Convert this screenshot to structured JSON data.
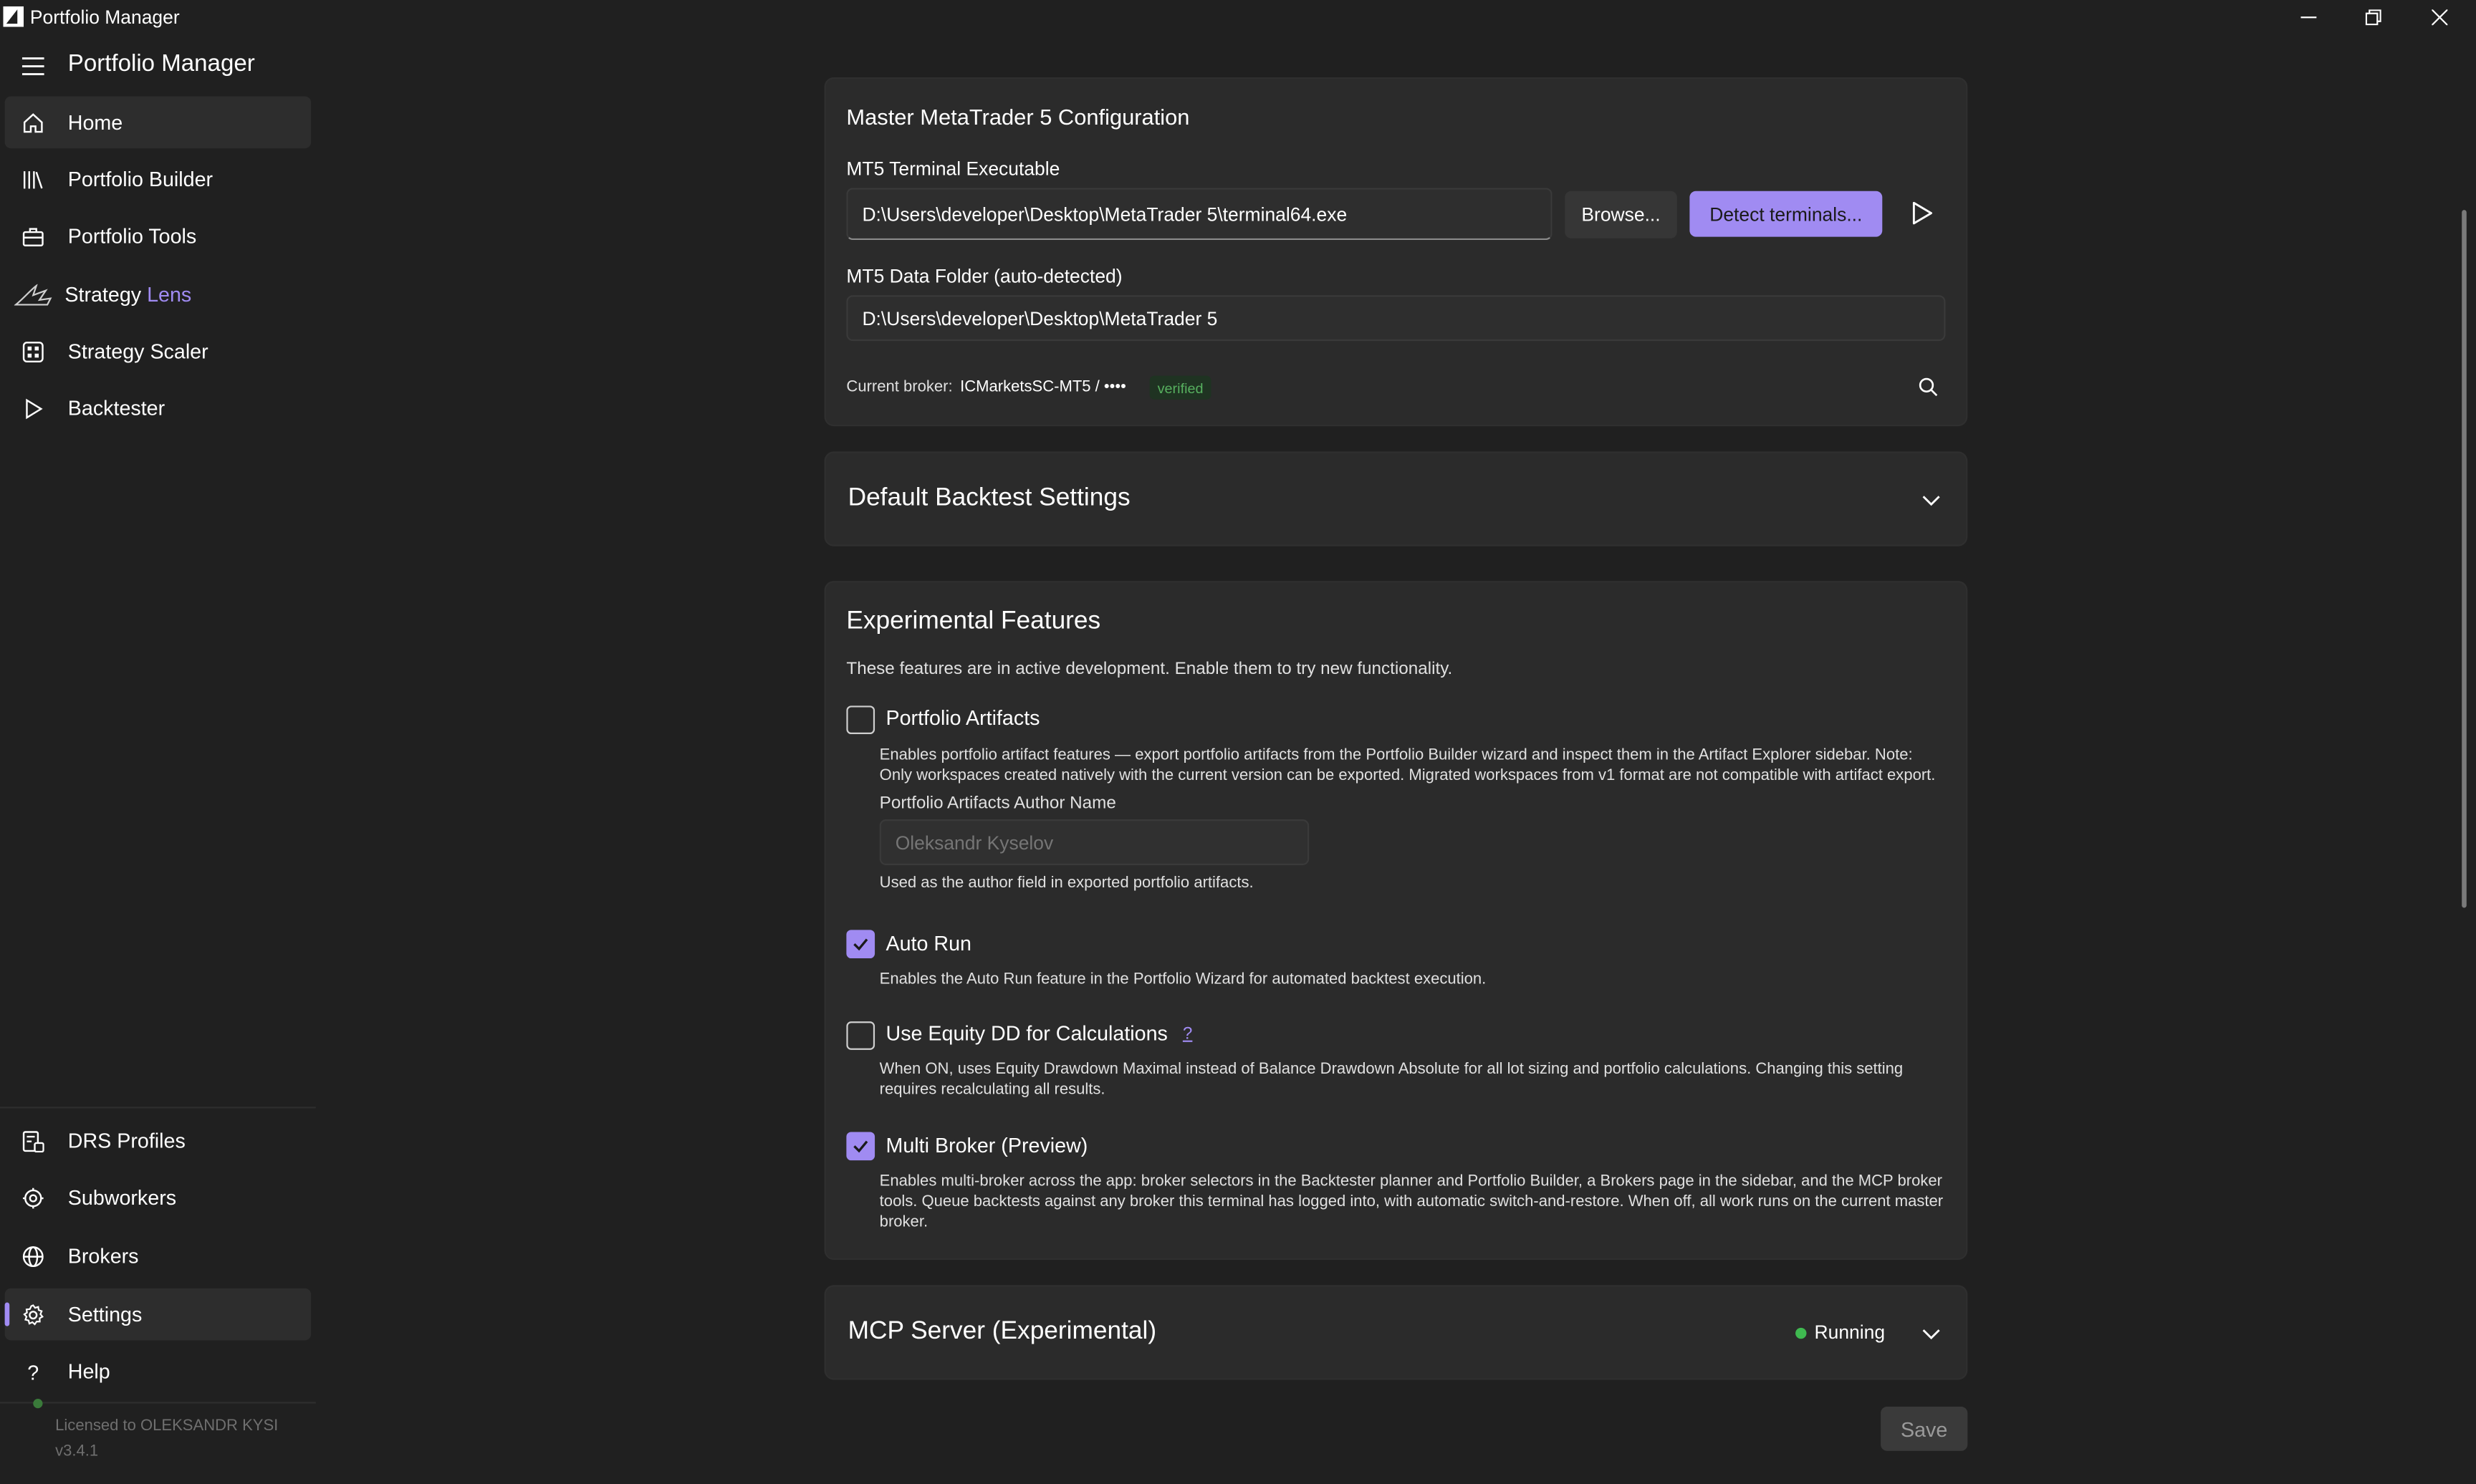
{
  "window": {
    "title": "Portfolio Manager"
  },
  "sidebar": {
    "app_name": "Portfolio Manager",
    "items": [
      {
        "label": "Home"
      },
      {
        "label": "Portfolio Builder"
      },
      {
        "label": "Portfolio Tools"
      },
      {
        "label_a": "Strategy",
        "label_b": "Lens"
      },
      {
        "label": "Strategy Scaler"
      },
      {
        "label": "Backtester"
      }
    ],
    "bottom_items": [
      {
        "label": "DRS Profiles"
      },
      {
        "label": "Subworkers"
      },
      {
        "label": "Brokers"
      },
      {
        "label": "Settings"
      },
      {
        "label": "Help"
      }
    ],
    "license": "Licensed to OLEKSANDR KYSI",
    "version": "v3.4.1"
  },
  "mt5": {
    "title": "Master MetaTrader 5 Configuration",
    "exe_label": "MT5 Terminal Executable",
    "exe_value": "D:\\Users\\developer\\Desktop\\MetaTrader 5\\terminal64.exe",
    "browse_label": "Browse...",
    "detect_label": "Detect terminals...",
    "data_label": "MT5 Data Folder (auto-detected)",
    "data_value": "D:\\Users\\developer\\Desktop\\MetaTrader 5",
    "broker_prefix": "Current broker:",
    "broker_value": "ICMarketsSC-MT5 / ••••",
    "broker_badge": "verified"
  },
  "backtest": {
    "title": "Default Backtest Settings"
  },
  "experimental": {
    "title": "Experimental Features",
    "subtitle": "These features are in active development. Enable them to try new functionality.",
    "artifacts": {
      "label": "Portfolio Artifacts",
      "checked": false,
      "desc1": "Enables portfolio artifact features — export portfolio artifacts from the Portfolio Builder wizard and inspect them in the Artifact Explorer sidebar. Note:",
      "desc2": "Only workspaces created natively with the current version can be exported. Migrated workspaces from v1 format are not compatible with artifact export.",
      "author_label": "Portfolio Artifacts Author Name",
      "author_placeholder": "Oleksandr Kyselov",
      "author_help": "Used as the author field in exported portfolio artifacts."
    },
    "autorun": {
      "label": "Auto Run",
      "checked": true,
      "desc": "Enables the Auto Run feature in the Portfolio Wizard for automated backtest execution."
    },
    "equity": {
      "label": "Use Equity DD for Calculations",
      "help": "?",
      "checked": false,
      "desc1": "When ON, uses Equity Drawdown Maximal instead of Balance Drawdown Absolute for all lot sizing and portfolio calculations. Changing this setting",
      "desc2": "requires recalculating all results."
    },
    "multibroker": {
      "label": "Multi Broker (Preview)",
      "checked": true,
      "desc1": "Enables multi-broker across the app: broker selectors in the Backtester planner and Portfolio Builder, a Brokers page in the sidebar, and the MCP broker",
      "desc2": "tools. Queue backtests against any broker this terminal has logged into, with automatic switch-and-restore. When off, all work runs on the current master",
      "desc3": "broker."
    }
  },
  "mcp": {
    "title": "MCP Server (Experimental)",
    "status": "Running"
  },
  "save_label": "Save",
  "colors": {
    "accent": "#a08bf2",
    "background": "#202020",
    "card": "#2b2b2b",
    "status_green": "#3fb950"
  }
}
